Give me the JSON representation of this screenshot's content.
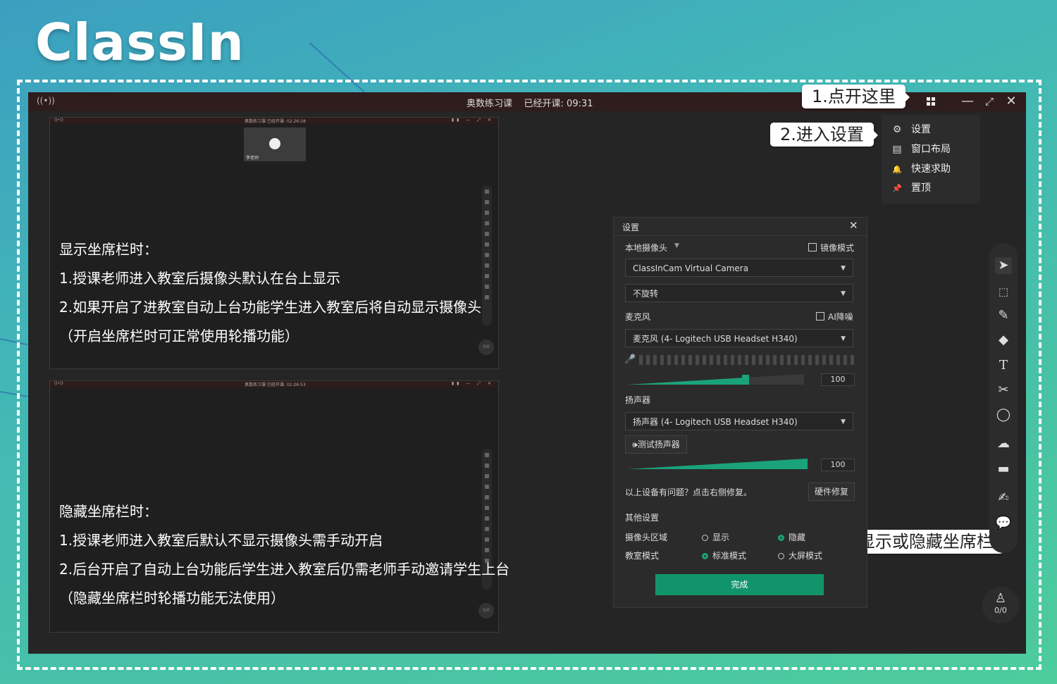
{
  "logo": {
    "text": "ClassIn"
  },
  "titlebar": {
    "signal_icon": "((•))",
    "course": "奥数练习课",
    "elapsed": "已经开课: 09:31",
    "minimize": "—",
    "restore": "⤢",
    "close": "✕"
  },
  "menu": {
    "items": [
      {
        "icon": "gear-icon",
        "glyph": "⚙",
        "label": "设置"
      },
      {
        "icon": "layout-icon",
        "glyph": "▤",
        "label": "窗口布局"
      },
      {
        "icon": "bell-icon",
        "glyph": "🔔",
        "label": "快速求助"
      },
      {
        "icon": "pin-icon",
        "glyph": "📌",
        "label": "置顶"
      }
    ]
  },
  "callouts": {
    "step1": "1.点开这里",
    "step2": "2.进入设置",
    "step3": "3.显示或隐藏坐席栏"
  },
  "screenshots": [
    {
      "titlebar_title": "奥数练习课   已经开课: 02:26:28",
      "teacher_name": "李老师",
      "heading": "显示坐席栏时：",
      "lines": [
        "1.授课老师进入教室后摄像头默认在台上显示",
        "2.如果开启了进教室自动上台功能学生进入教室后将自动显示摄像头",
        "（开启坐席栏时可正常使用轮播功能）"
      ],
      "seat_count": "0/0"
    },
    {
      "titlebar_title": "奥数练习课   已经开课: 02:26:53",
      "heading": "隐藏坐席栏时：",
      "lines": [
        "1.授课老师进入教室后默认不显示摄像头需手动开启",
        "2.后台开启了自动上台功能后学生进入教室后仍需老师手动邀请学生上台",
        "（隐藏坐席栏时轮播功能无法使用）"
      ],
      "seat_count": "0/0"
    }
  ],
  "settings": {
    "title": "设置",
    "camera_label": "本地摄像头",
    "mirror_label": "镜像模式",
    "camera_device": "ClassInCam Virtual Camera",
    "rotation": "不旋转",
    "mic_label": "麦克风",
    "ai_noise_label": "AI降噪",
    "mic_device": "麦克风 (4- Logitech USB Headset H340)",
    "mic_volume": "100",
    "speaker_label": "扬声器",
    "speaker_device": "扬声器 (4- Logitech USB Headset H340)",
    "test_speaker": "测试扬声器",
    "speaker_volume": "100",
    "device_problem": "以上设备有问题？点击右侧修复。",
    "hardware_fix": "硬件修复",
    "other_settings": "其他设置",
    "camera_area_label": "摄像头区域",
    "camera_area_show": "显示",
    "camera_area_hide": "隐藏",
    "camera_area_selected": "隐藏",
    "classroom_mode_label": "教室模式",
    "mode_standard": "标准模式",
    "mode_bigscreen": "大屏模式",
    "mode_selected": "标准模式",
    "done": "完成"
  },
  "toolbar": {
    "tools": [
      "pointer-icon",
      "selection-icon",
      "pen-icon",
      "eraser-icon",
      "text-icon",
      "scissors-icon",
      "shape-icon",
      "cloud-icon",
      "toolbox-icon",
      "edit-icon",
      "chat-icon"
    ],
    "seat_count": "0/0"
  },
  "colors": {
    "accent": "#12946a",
    "window_bg": "#252525",
    "titlebar_bg": "#2f1c1c"
  }
}
